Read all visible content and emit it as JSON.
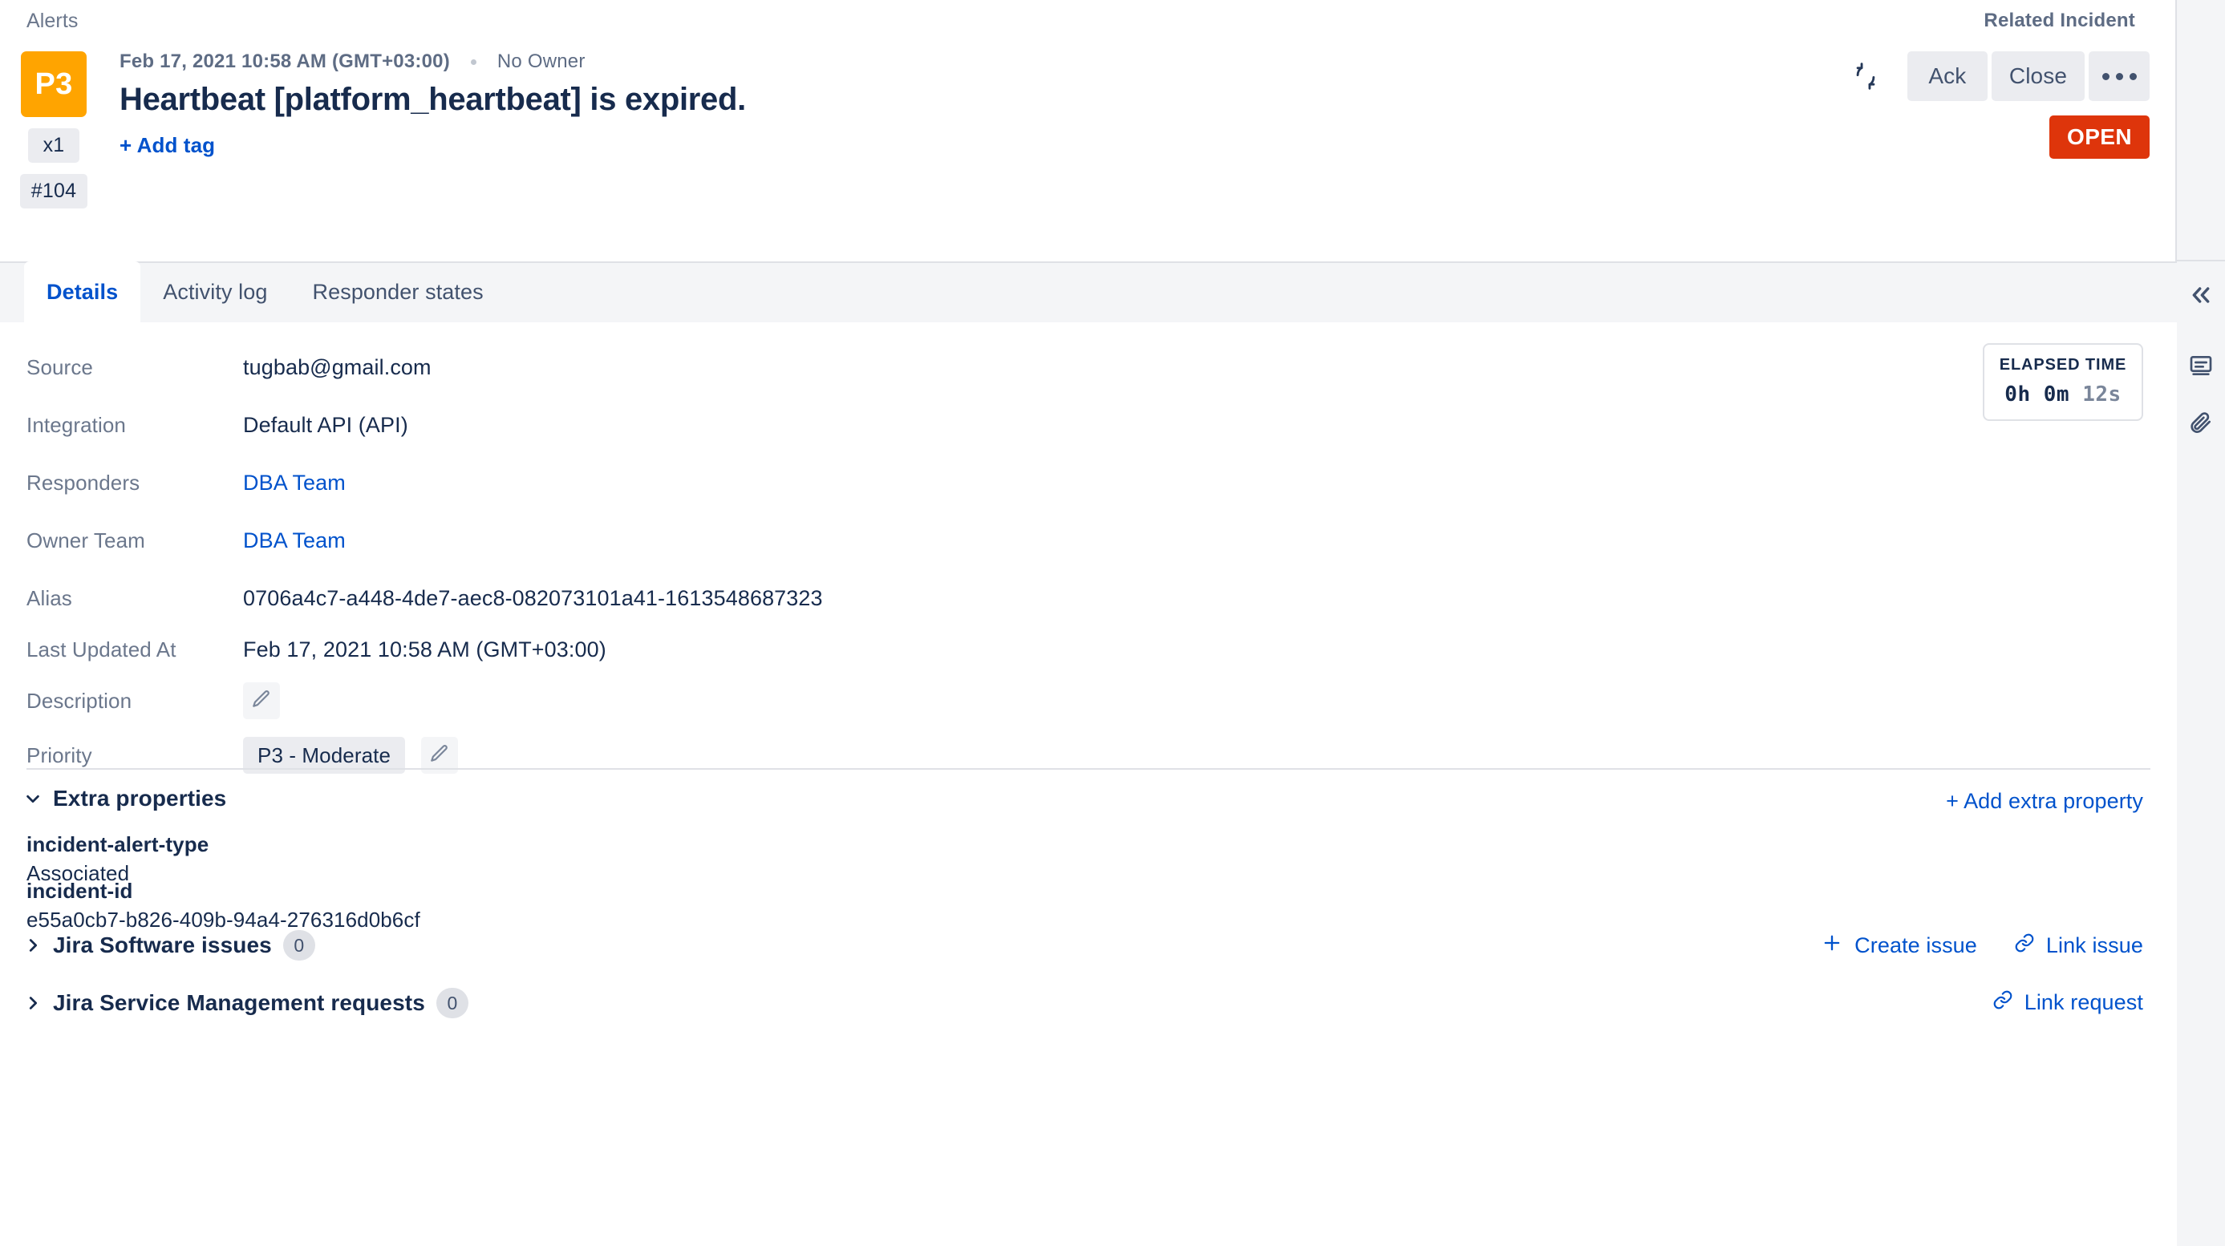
{
  "breadcrumb": {
    "label": "Alerts"
  },
  "header": {
    "related_incident_label": "Related Incident",
    "priority_badge": "P3",
    "count_chip": "x1",
    "id_chip": "#104",
    "created_at": "Feb 17, 2021 10:58 AM (GMT+03:00)",
    "owner": "No Owner",
    "title": "Heartbeat [platform_heartbeat] is expired.",
    "add_tag_label": "+ Add tag",
    "refresh_icon": "refresh-icon",
    "ack_label": "Ack",
    "close_label": "Close",
    "more_icon": "ellipsis-icon",
    "status_label": "OPEN",
    "status_color": "#de350b",
    "priority_color": "#FFA400"
  },
  "tabs": [
    {
      "label": "Details",
      "active": true
    },
    {
      "label": "Activity log",
      "active": false
    },
    {
      "label": "Responder states",
      "active": false
    }
  ],
  "details": {
    "fields": [
      {
        "label": "Source",
        "value": "tugbab@gmail.com",
        "kind": "text"
      },
      {
        "label": "Integration",
        "value": "Default API (API)",
        "kind": "text"
      },
      {
        "label": "Responders",
        "value": "DBA Team",
        "kind": "link"
      },
      {
        "label": "Owner Team",
        "value": "DBA Team",
        "kind": "link"
      },
      {
        "label": "Alias",
        "value": "0706a4c7-a448-4de7-aec8-082073101a41-1613548687323",
        "kind": "text"
      },
      {
        "label": "Last Updated At",
        "value": "Feb 17, 2021 10:58 AM (GMT+03:00)",
        "kind": "text"
      },
      {
        "label": "Description",
        "value": "",
        "kind": "edit"
      },
      {
        "label": "Priority",
        "value": "P3 - Moderate",
        "kind": "chip-edit"
      }
    ]
  },
  "elapsed": {
    "title": "ELAPSED TIME",
    "hours": "0h",
    "minutes": "0m",
    "seconds": "12s"
  },
  "extra_properties": {
    "title": "Extra properties",
    "add_label": "+ Add extra property",
    "items": [
      {
        "key": "incident-alert-type",
        "value": "Associated"
      },
      {
        "key": "incident-id",
        "value": "e55a0cb7-b826-409b-94a4-276316d0b6cf"
      }
    ]
  },
  "jira_software": {
    "title": "Jira Software issues",
    "count": "0",
    "create_label": "Create issue",
    "link_label": "Link issue"
  },
  "jira_service_management": {
    "title": "Jira Service Management requests",
    "count": "0",
    "link_label": "Link request"
  },
  "rail": {
    "collapse_icon": "double-chevron-left-icon",
    "notes_icon": "notes-icon",
    "attachment_icon": "paperclip-icon"
  }
}
